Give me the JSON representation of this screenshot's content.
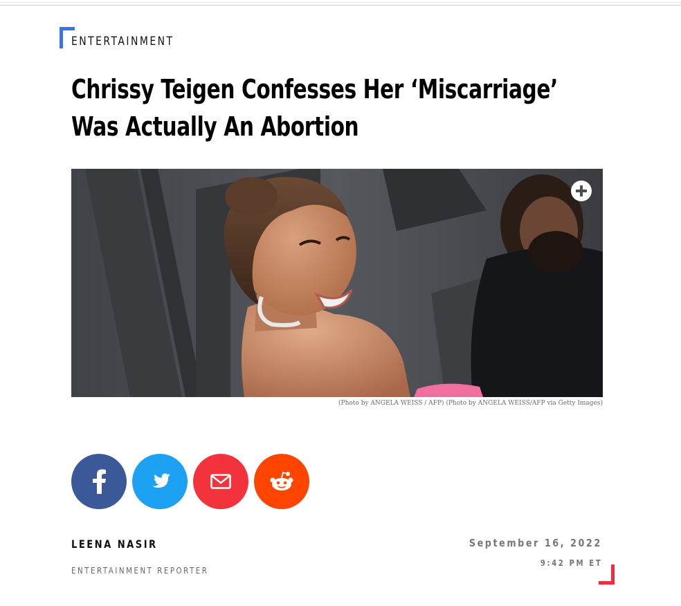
{
  "article": {
    "category": "ENTERTAINMENT",
    "headline_line1": "Chrissy Teigen Confesses Her ‘Miscarriage’",
    "headline_line2": "Was Actually An Abortion",
    "image_caption": "(Photo by ANGELA WEISS / AFP) (Photo by ANGELA WEISS/AFP via Getty Images)",
    "image_expand_icon": "plus-circle-icon"
  },
  "share": [
    {
      "network": "facebook",
      "icon": "facebook-icon",
      "color": "#3b5998"
    },
    {
      "network": "twitter",
      "icon": "twitter-icon",
      "color": "#1da1f2"
    },
    {
      "network": "email",
      "icon": "email-icon",
      "color": "#f3333b"
    },
    {
      "network": "reddit",
      "icon": "reddit-icon",
      "color": "#ff4500"
    }
  ],
  "byline": {
    "author": "LEENA NASIR",
    "role": "ENTERTAINMENT REPORTER",
    "date": "September 16, 2022",
    "time": "9:42 PM ET"
  },
  "colors": {
    "accent_blue": "#3b73e8",
    "accent_red": "#ee2e3a"
  }
}
